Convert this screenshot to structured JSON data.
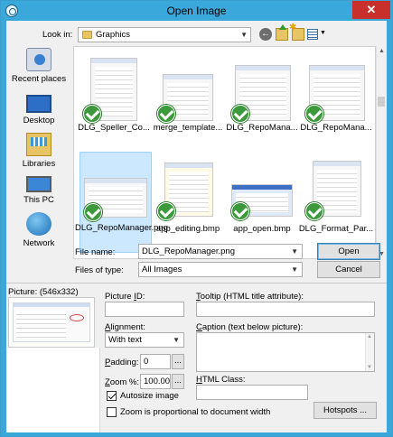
{
  "window": {
    "title": "Open Image",
    "close_glyph": "✕"
  },
  "toolbar": {
    "look_in_label": "Look in:",
    "look_in_value": "Graphics"
  },
  "places": [
    {
      "label": "Recent places",
      "icon": "recent-places-icon"
    },
    {
      "label": "Desktop",
      "icon": "desktop-icon"
    },
    {
      "label": "Libraries",
      "icon": "libraries-icon"
    },
    {
      "label": "This PC",
      "icon": "this-pc-icon"
    },
    {
      "label": "Network",
      "icon": "network-icon"
    }
  ],
  "files": [
    {
      "label": "DLG_Speller_Co...",
      "selected": false
    },
    {
      "label": "merge_template...",
      "selected": false
    },
    {
      "label": "DLG_RepoMana...",
      "selected": false
    },
    {
      "label": "DLG_RepoMana...",
      "selected": false
    },
    {
      "label": "DLG_RepoManager.png",
      "selected": true
    },
    {
      "label": "app_editing.bmp",
      "selected": false
    },
    {
      "label": "app_open.bmp",
      "selected": false
    },
    {
      "label": "DLG_Format_Par...",
      "selected": false
    }
  ],
  "file_name": {
    "label": "File name:",
    "value": "DLG_RepoManager.png"
  },
  "files_of_type": {
    "label": "Files of type:",
    "value": "All Images"
  },
  "buttons": {
    "open": "Open",
    "cancel": "Cancel",
    "hotspots": "Hotspots ...",
    "padding_browse": "..."
  },
  "picture": {
    "label": "Picture: (546x332)"
  },
  "form": {
    "picture_id_label_pre": "Picture ",
    "picture_id_label_key": "I",
    "picture_id_label_post": "D:",
    "picture_id_value": "",
    "tooltip_label_key": "T",
    "tooltip_label_post": "ooltip (HTML title attribute):",
    "tooltip_value": "",
    "alignment_label_key": "A",
    "alignment_label_post": "lignment:",
    "alignment_value": "With text",
    "caption_label_key": "C",
    "caption_label_post": "aption (text below picture):",
    "caption_value": "",
    "padding_label_key": "P",
    "padding_label_post": "adding:",
    "padding_value": "0",
    "zoom_label_key": "Z",
    "zoom_label_post": "oom %:",
    "zoom_value": "100.00",
    "html_class_label_key": "H",
    "html_class_label_post": "TML Class:",
    "html_class_value": "",
    "autosize_label": "Autosize image",
    "autosize_checked": true,
    "zoom_proportional_label": "Zoom is proportional to document width",
    "zoom_proportional_checked": false
  }
}
